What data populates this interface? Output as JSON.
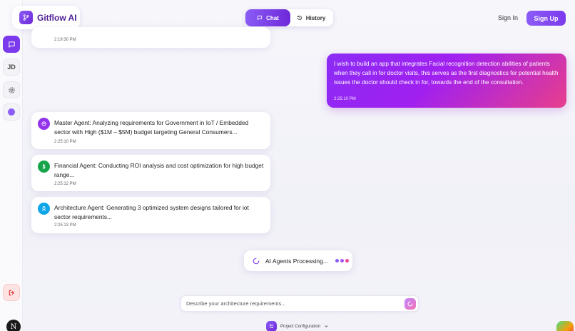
{
  "brand": {
    "name": "Gitflow AI"
  },
  "header": {
    "tabs": [
      {
        "label": "Chat"
      },
      {
        "label": "History"
      }
    ],
    "sign_in": "Sign In",
    "sign_up": "Sign Up"
  },
  "sidebar": {
    "items": [
      {
        "icon": "chat-icon"
      },
      {
        "label": "JD"
      },
      {
        "icon": "gear-icon"
      },
      {
        "icon": "status-dot-icon"
      }
    ],
    "logout_icon": "logout-icon",
    "avatar_letter": "N"
  },
  "messages": {
    "top_partial_time": "2:19:30 PM",
    "user": {
      "text": "I wish to build an app that integrates Facial recognition detection abilities of patients when they call in for doctor visits, this serves as the first diagnostics for potential health issues the doctor should check in for, towards the end of the consultation.",
      "time": "2:25:10 PM"
    },
    "agents": [
      {
        "icon": "brain-icon",
        "text": "Master Agent: Analyzing requirements for Government in IoT / Embedded sector with High ($1M – $5M) budget targeting General Consumers...",
        "time": "2:25:10 PM",
        "color": "#9333ea"
      },
      {
        "icon": "dollar-icon",
        "text": "Financial Agent: Conducting ROI analysis and cost optimization for high budget range...",
        "time": "2:25:12 PM",
        "color": "#16a34a"
      },
      {
        "icon": "rocket-icon",
        "text": "Architecture Agent: Generating 3 optimized system designs tailored for iot sector requirements...",
        "time": "2:25:13 PM",
        "color": "#0ea5e9"
      }
    ]
  },
  "processing": {
    "label": "AI Agents Processing..."
  },
  "composer": {
    "placeholder": "Describe your architecture requirements..."
  },
  "project_config": {
    "label": "Project Configuration"
  },
  "colors": {
    "accent": "#7c3aed",
    "pink": "#ec4899"
  }
}
